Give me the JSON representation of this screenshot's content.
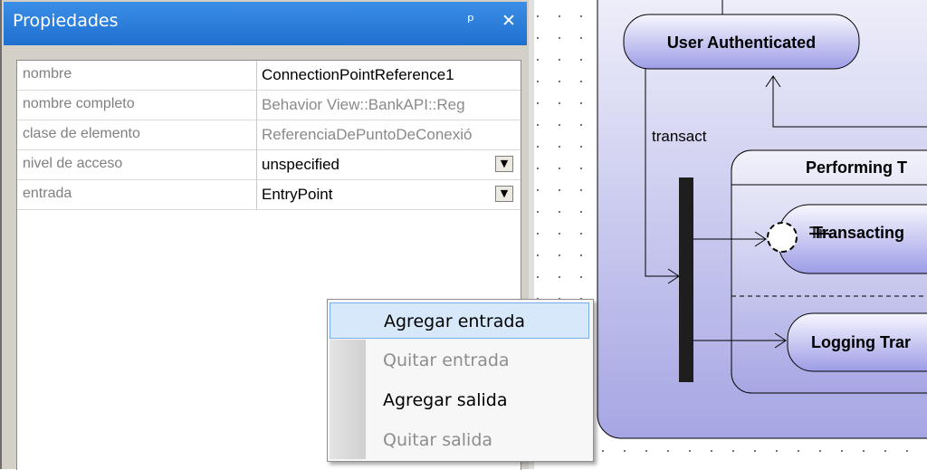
{
  "panel": {
    "title": "Propiedades",
    "pin_glyph": "ᵖ",
    "close_glyph": "✕",
    "properties": [
      {
        "name": "nombre",
        "value": "ConnectionPointReference1",
        "grey": false,
        "dropdown": false
      },
      {
        "name": "nombre completo",
        "value": "Behavior View::BankAPI::Reg",
        "grey": true,
        "dropdown": false
      },
      {
        "name": "clase de elemento",
        "value": "ReferenciaDePuntoDeConexió",
        "grey": true,
        "dropdown": false
      },
      {
        "name": "nivel de acceso",
        "value": "unspecified",
        "grey": false,
        "dropdown": true
      },
      {
        "name": "entrada",
        "value": "EntryPoint",
        "grey": false,
        "dropdown": true
      }
    ]
  },
  "context_menu": {
    "items": [
      {
        "label": "Agregar entrada",
        "enabled": true,
        "highlighted": true
      },
      {
        "label": "Quitar entrada",
        "enabled": false,
        "highlighted": false
      },
      {
        "label": "Agregar salida",
        "enabled": true,
        "highlighted": false
      },
      {
        "label": "Quitar salida",
        "enabled": false,
        "highlighted": false
      }
    ]
  },
  "diagram": {
    "state_user_authenticated": "User Authenticated",
    "transition_label": "transact",
    "composite_state_title": "Performing T",
    "state_transacting": "Transacting",
    "state_transacting_overlay": "Tr",
    "state_logging": "Logging Trar"
  },
  "colors": {
    "title_bar": "#1f6fd0",
    "menu_highlight": "#d6e8fa",
    "state_fill_top": "#f4f4ff",
    "state_fill_bottom": "#8c8ce0"
  }
}
